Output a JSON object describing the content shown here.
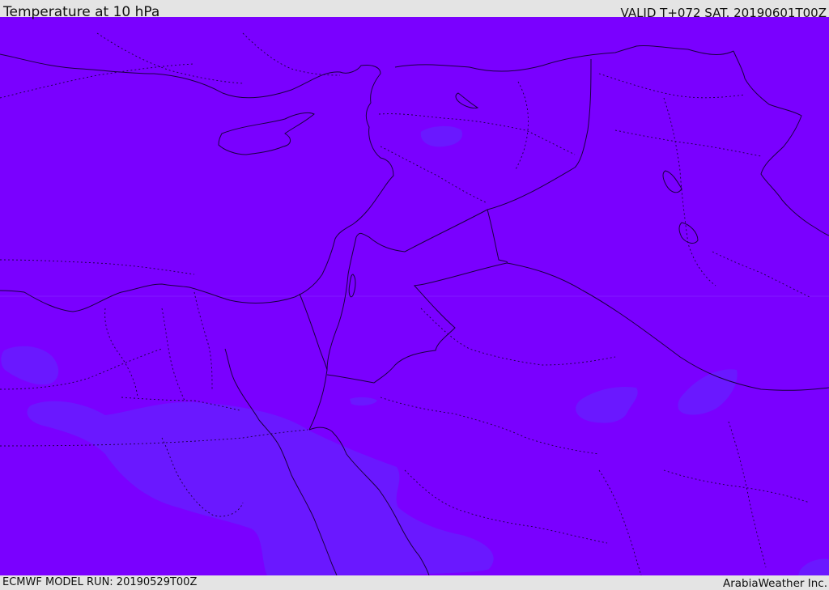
{
  "header": {
    "title": "Temperature at 10 hPa",
    "valid": "VALID T+072 SAT. 20190601T00Z"
  },
  "footer": {
    "model_run": "ECMWF MODEL RUN: 20190529T00Z",
    "credit": "ArabiaWeather Inc."
  },
  "map": {
    "variable": "Temperature",
    "level": "10 hPa",
    "colors": {
      "base_fill": "#7a00ff",
      "contour_fill": "#6a18ff",
      "coastline": "#1a0040",
      "border": "#1a0040"
    }
  }
}
